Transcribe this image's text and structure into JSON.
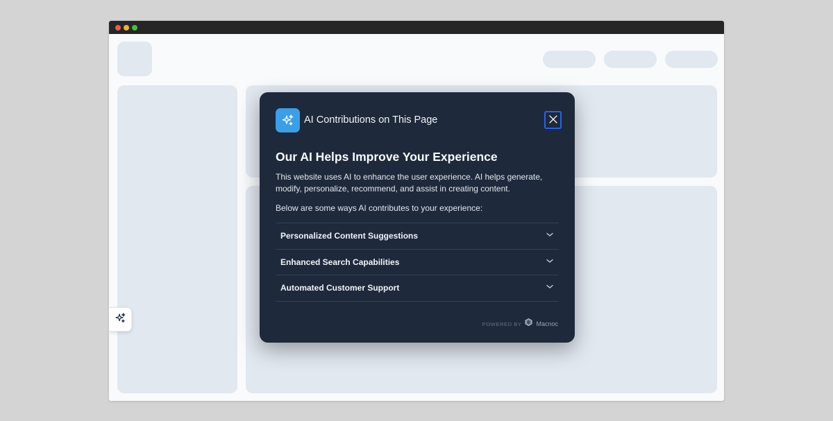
{
  "modal": {
    "header_title": "AI Contributions on This Page",
    "heading": "Our AI Helps Improve Your Experience",
    "description": "This website uses AI to enhance the user experience. AI helps generate, modify, personalize, recommend, and assist in creating content.",
    "subheading": "Below are some ways AI contributes to your experience:",
    "items": [
      {
        "label": "Personalized Content Suggestions",
        "icon": "chevron-down-icon"
      },
      {
        "label": "Enhanced Search Capabilities",
        "icon": "chevron-down-icon"
      },
      {
        "label": "Automated Customer Support",
        "icon": "chevron-down-icon"
      }
    ],
    "powered_by": "POWERED BY",
    "brand": "Macnoc",
    "icons": {
      "header": "sparkles-icon",
      "close": "close-icon",
      "brand": "macnoc-logo-icon"
    }
  },
  "floating_button": {
    "icon": "sparkles-icon"
  },
  "colors": {
    "modal_bg": "#1e293b",
    "accent": "#3b9fe8",
    "focus_ring": "#2563eb",
    "page_bg": "#f8fafc",
    "skeleton": "#e2e8f0"
  }
}
